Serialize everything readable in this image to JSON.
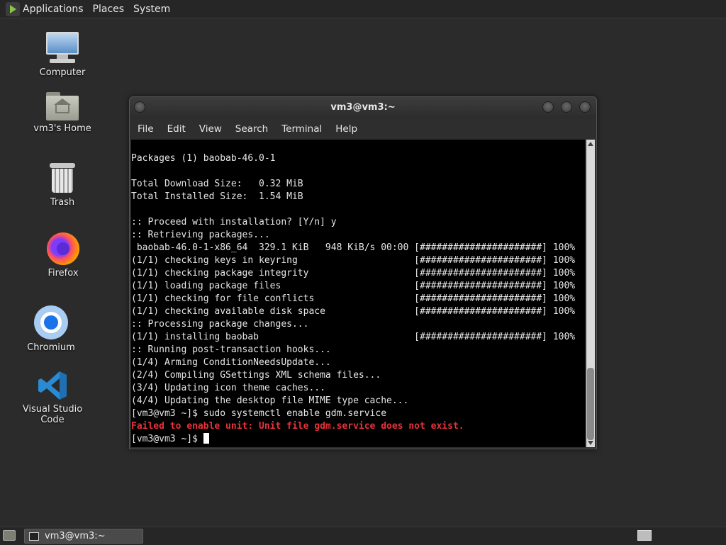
{
  "top_panel": {
    "menus": [
      "Applications",
      "Places",
      "System"
    ]
  },
  "desktop_icons": {
    "computer": "Computer",
    "home": "vm3's Home",
    "trash": "Trash",
    "firefox": "Firefox",
    "chromium": "Chromium",
    "vscode": "Visual Studio Code"
  },
  "window": {
    "title": "vm3@vm3:~",
    "menus": [
      "File",
      "Edit",
      "View",
      "Search",
      "Terminal",
      "Help"
    ]
  },
  "terminal": {
    "lines": [
      "",
      "Packages (1) baobab-46.0-1",
      "",
      "Total Download Size:   0.32 MiB",
      "Total Installed Size:  1.54 MiB",
      "",
      ":: Proceed with installation? [Y/n] y",
      ":: Retrieving packages...",
      " baobab-46.0-1-x86_64  329.1 KiB   948 KiB/s 00:00 [######################] 100%",
      "(1/1) checking keys in keyring                     [######################] 100%",
      "(1/1) checking package integrity                   [######################] 100%",
      "(1/1) loading package files                        [######################] 100%",
      "(1/1) checking for file conflicts                  [######################] 100%",
      "(1/1) checking available disk space                [######################] 100%",
      ":: Processing package changes...",
      "(1/1) installing baobab                            [######################] 100%",
      ":: Running post-transaction hooks...",
      "(1/4) Arming ConditionNeedsUpdate...",
      "(2/4) Compiling GSettings XML schema files...",
      "(3/4) Updating icon theme caches...",
      "(4/4) Updating the desktop file MIME type cache...",
      "[vm3@vm3 ~]$ sudo systemctl enable gdm.service"
    ],
    "error_line": "Failed to enable unit: Unit file gdm.service does not exist.",
    "prompt": "[vm3@vm3 ~]$ ",
    "error_color": "#e8323b"
  },
  "taskbar": {
    "task_label": "vm3@vm3:~"
  }
}
